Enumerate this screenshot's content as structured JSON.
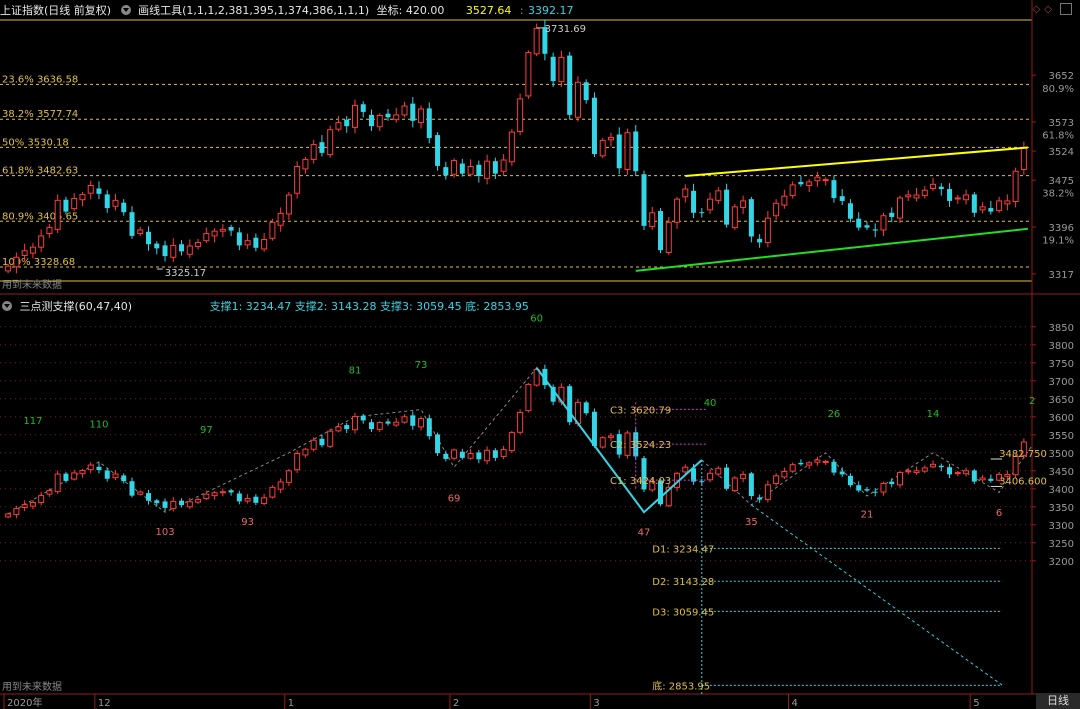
{
  "colors": {
    "up": "#ff3b3b",
    "down": "#33d6e6",
    "fib_line": "#e0c040",
    "upper_channel": "#ffff00",
    "lower_channel": "#22dd22",
    "cyan_line": "#33d6e6",
    "grid_dot": "#7a1a1a",
    "magenta": "#d040d0",
    "peak_label": "#22bb22",
    "trough_label": "#ee6666"
  },
  "top_panel": {
    "title": "上证指数(日线 前复权)",
    "tool_label": "画线工具(1,1,1,2,381,395,1,374,386,1,1,1)",
    "coord_label": "坐标: 420.00",
    "value_a": "3527.64",
    "value_b": "3392.17",
    "high_label": "3731.69",
    "low_label": "3325.17",
    "fib_levels": [
      {
        "text": "23.6% 3636.58",
        "value": 3636.58
      },
      {
        "text": "38.2% 3577.74",
        "value": 3577.74
      },
      {
        "text": "50% 3530.18",
        "value": 3530.18
      },
      {
        "text": "61.8% 3482.63",
        "value": 3482.63
      },
      {
        "text": "80.9% 3405.65",
        "value": 3405.65
      },
      {
        "text": "100% 3328.68",
        "value": 3328.68
      }
    ],
    "future_label": "用到未来数据",
    "y_ticks": [
      {
        "text": "3652",
        "value": 3652
      },
      {
        "text": "80.9%",
        "value": 3630
      },
      {
        "text": "3573",
        "value": 3573
      },
      {
        "text": "61.8%",
        "value": 3552
      },
      {
        "text": "3524",
        "value": 3524
      },
      {
        "text": "3475",
        "value": 3475
      },
      {
        "text": "38.2%",
        "value": 3454
      },
      {
        "text": "3396",
        "value": 3396
      },
      {
        "text": "19.1%",
        "value": 3375
      },
      {
        "text": "3317",
        "value": 3317
      }
    ],
    "ymin": 3305,
    "ymax": 3745
  },
  "bottom_panel": {
    "title": "三点测支撑(60,47,40)",
    "support_text": "支撑1: 3234.47  支撑2: 3143.28  支撑3: 3059.45  底: 2853.95",
    "peak_labels": [
      {
        "text": "117",
        "idx": 3,
        "value": 3580
      },
      {
        "text": "110",
        "idx": 11,
        "value": 3570
      },
      {
        "text": "97",
        "idx": 24,
        "value": 3555
      },
      {
        "text": "81",
        "idx": 42,
        "value": 3720
      },
      {
        "text": "73",
        "idx": 50,
        "value": 3735
      },
      {
        "text": "60",
        "idx": 64,
        "value": 3865
      },
      {
        "text": "40",
        "idx": 85,
        "value": 3630
      },
      {
        "text": "26",
        "idx": 100,
        "value": 3600
      },
      {
        "text": "14",
        "idx": 112,
        "value": 3600
      },
      {
        "text": "2",
        "idx": 124,
        "value": 3635
      }
    ],
    "trough_labels": [
      {
        "text": "103",
        "idx": 19,
        "value": 3272
      },
      {
        "text": "93",
        "idx": 29,
        "value": 3300
      },
      {
        "text": "69",
        "idx": 54,
        "value": 3365
      },
      {
        "text": "47",
        "idx": 77,
        "value": 3270
      },
      {
        "text": "35",
        "idx": 90,
        "value": 3300
      },
      {
        "text": "21",
        "idx": 104,
        "value": 3320
      },
      {
        "text": "6",
        "idx": 120,
        "value": 3325
      }
    ],
    "c_levels": [
      {
        "text": "C3: 3620.79",
        "value": 3620.79
      },
      {
        "text": "C2: 3524.23",
        "value": 3524.23
      },
      {
        "text": "C1: 3424.03",
        "value": 3424.03
      }
    ],
    "d_levels": [
      {
        "text": "D1: 3234.47",
        "value": 3234.47
      },
      {
        "text": "D2: 3143.28",
        "value": 3143.28
      },
      {
        "text": "D3: 3059.45",
        "value": 3059.45
      },
      {
        "text": "底: 2853.95",
        "value": 2853.95
      }
    ],
    "right_labels": [
      {
        "text": "3482.750",
        "value": 3482.75
      },
      {
        "text": "3406.600",
        "value": 3406.6
      }
    ],
    "future_label": "用到未来数据",
    "y_ticks": [
      3850,
      3800,
      3750,
      3700,
      3650,
      3600,
      3550,
      3500,
      3450,
      3400,
      3350,
      3300,
      3250,
      3200
    ],
    "ymin": 2830,
    "ymax": 3880
  },
  "x_axis": [
    {
      "text": "2020年",
      "idx": 0
    },
    {
      "text": "12",
      "idx": 11
    },
    {
      "text": "1",
      "idx": 34
    },
    {
      "text": "2",
      "idx": 54
    },
    {
      "text": "3",
      "idx": 71
    },
    {
      "text": "4",
      "idx": 95
    },
    {
      "text": "5",
      "idx": 117
    }
  ],
  "period_tab": "日线",
  "chart_data": {
    "type": "candlestick",
    "closes": [
      3330,
      3345,
      3356,
      3362,
      3381,
      3395,
      3441,
      3422,
      3444,
      3451,
      3466,
      3452,
      3428,
      3441,
      3421,
      3381,
      3391,
      3367,
      3360,
      3347,
      3365,
      3355,
      3364,
      3370,
      3385,
      3389,
      3392,
      3390,
      3365,
      3373,
      3361,
      3375,
      3404,
      3419,
      3450,
      3498,
      3510,
      3535,
      3521,
      3560,
      3572,
      3566,
      3601,
      3590,
      3566,
      3584,
      3581,
      3585,
      3600,
      3575,
      3595,
      3546,
      3499,
      3483,
      3508,
      3486,
      3498,
      3482,
      3507,
      3486,
      3509,
      3556,
      3612,
      3690,
      3731,
      3688,
      3642,
      3682,
      3585,
      3640,
      3610,
      3519,
      3542,
      3547,
      3495,
      3555,
      3490,
      3398,
      3420,
      3357,
      3404,
      3443,
      3460,
      3420,
      3420,
      3443,
      3457,
      3400,
      3430,
      3440,
      3380,
      3370,
      3411,
      3436,
      3448,
      3467,
      3468,
      3472,
      3480,
      3476,
      3445,
      3440,
      3410,
      3395,
      3395,
      3390,
      3415,
      3413,
      3445,
      3450,
      3450,
      3458,
      3468,
      3460,
      3440,
      3445,
      3450,
      3420,
      3430,
      3422,
      3440,
      3440,
      3490,
      3530
    ]
  }
}
